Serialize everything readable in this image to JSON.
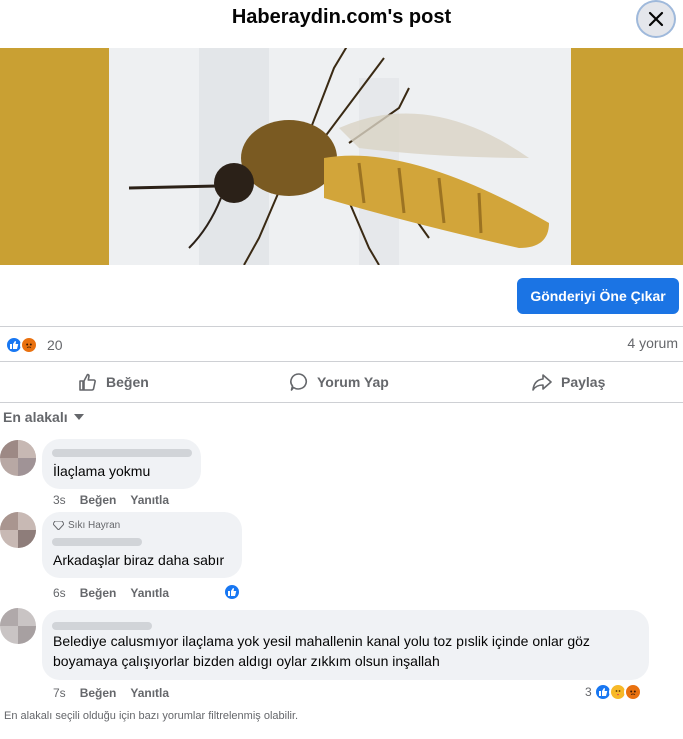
{
  "header": {
    "title": "Haberaydin.com's post"
  },
  "icons": {
    "close": "close-icon",
    "like": "like-thumb-icon",
    "comment": "comment-bubble-icon",
    "share": "share-arrow-icon",
    "caret": "caret-down-icon",
    "diamond": "diamond-icon"
  },
  "post": {
    "image_alt": "mosquito-photo",
    "promote_label": "Gönderiyi Öne Çıkar",
    "reaction_count": "20",
    "comment_count": "4 yorum"
  },
  "actions": {
    "like": "Beğen",
    "comment": "Yorum Yap",
    "share": "Paylaş"
  },
  "sort": {
    "label": "En alakalı"
  },
  "comments": [
    {
      "text": "İlaçlama yokmu",
      "time": "3s",
      "like": "Beğen",
      "reply": "Yanıtla",
      "badge": ""
    },
    {
      "text": "Arkadaşlar biraz daha sabır",
      "time": "6s",
      "like": "Beğen",
      "reply": "Yanıtla",
      "badge": "Sıkı Hayran"
    },
    {
      "text_line1": "Belediye calusmıyor ilaçlama yok yesil mahallenin kanal yolu toz pıslik içinde onlar göz",
      "text_line2": "boyamaya çalışıyorlar bizden aldıgı oylar zıkkım olsun inşallah",
      "time": "7s",
      "like": "Beğen",
      "reply": "Yanıtla",
      "reaction_count": "3"
    }
  ],
  "footer": {
    "note": "En alakalı seçili olduğu için bazı yorumlar filtrelenmiş olabilir."
  },
  "colors": {
    "accent": "#1b74e4",
    "like": "#1877f2",
    "angry": "#e9710f",
    "bubble": "#f0f2f5"
  }
}
